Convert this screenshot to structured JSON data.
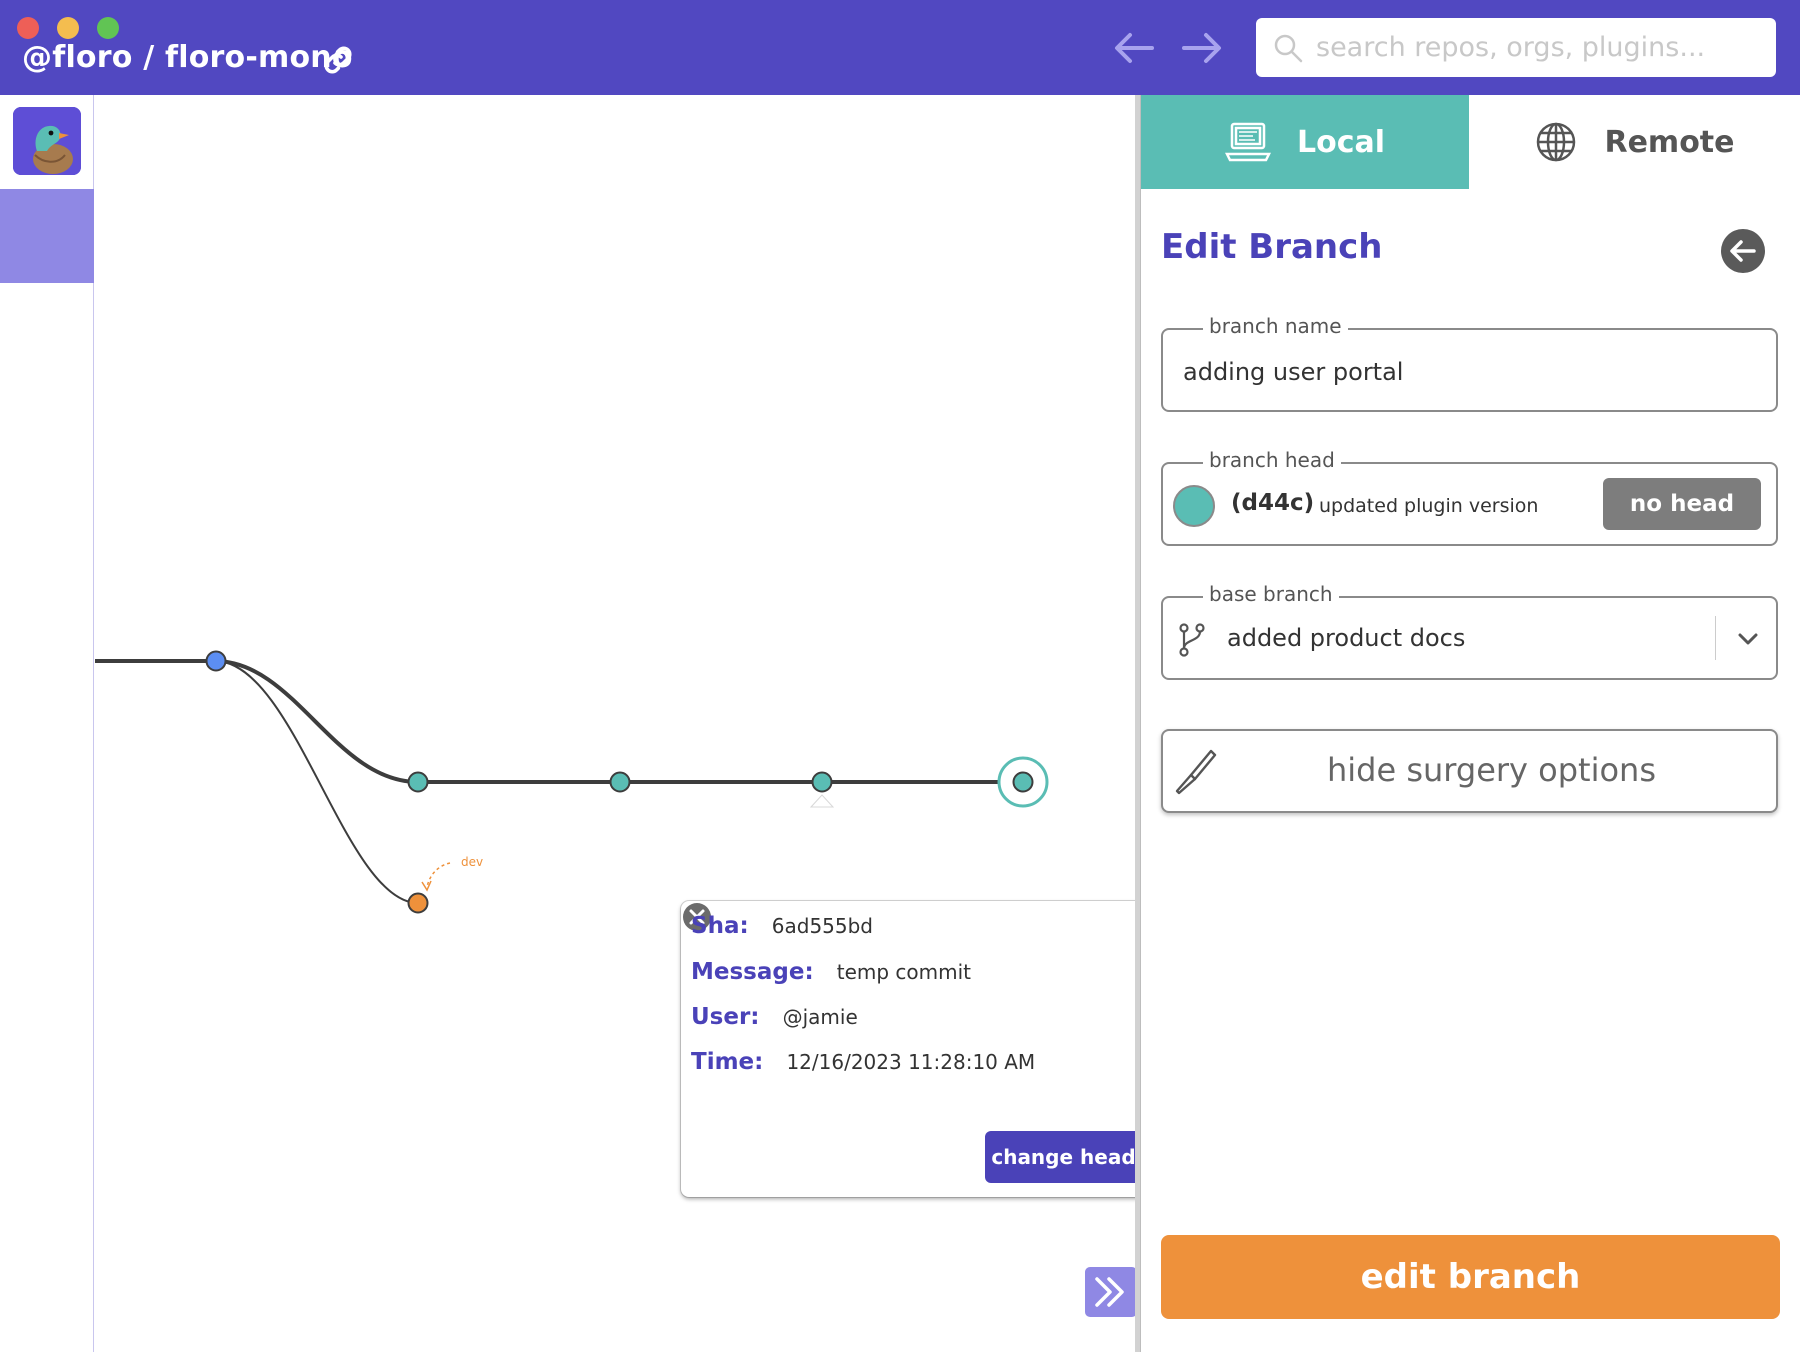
{
  "window": {
    "title": "@floro / floro-mono"
  },
  "search": {
    "placeholder": "search repos, orgs, plugins..."
  },
  "graph": {
    "branch_label": "dev",
    "colors": {
      "line": "#3d3d3d",
      "root_node": "#5c8ef2",
      "main_node": "#5abdb4",
      "dev_node": "#ee913b"
    }
  },
  "commit_tooltip": {
    "sha_label": "Sha:",
    "sha_value": "6ad555bd",
    "message_label": "Message:",
    "message_value": "temp commit",
    "user_label": "User:",
    "user_value": "@jamie",
    "time_label": "Time:",
    "time_value": "12/16/2023 11:28:10 AM",
    "change_head_label": "change head"
  },
  "panel": {
    "tabs": [
      {
        "label": "Local",
        "icon": "laptop-icon",
        "active": true
      },
      {
        "label": "Remote",
        "icon": "globe-icon",
        "active": false
      }
    ],
    "title": "Edit Branch",
    "branch_name": {
      "label": "branch name",
      "value": "adding user portal"
    },
    "branch_head": {
      "label": "branch head",
      "sha": "(d44c)",
      "message": "updated plugin version",
      "no_head_label": "no head"
    },
    "base_branch": {
      "label": "base branch",
      "value": "added product docs"
    },
    "surgery_label": "hide surgery options",
    "submit_label": "edit branch"
  },
  "colors": {
    "brand": "#5148c1",
    "accent_teal": "#5abdb4",
    "accent_orange": "#ee913b",
    "accent_purple_light": "#8f88e4"
  }
}
